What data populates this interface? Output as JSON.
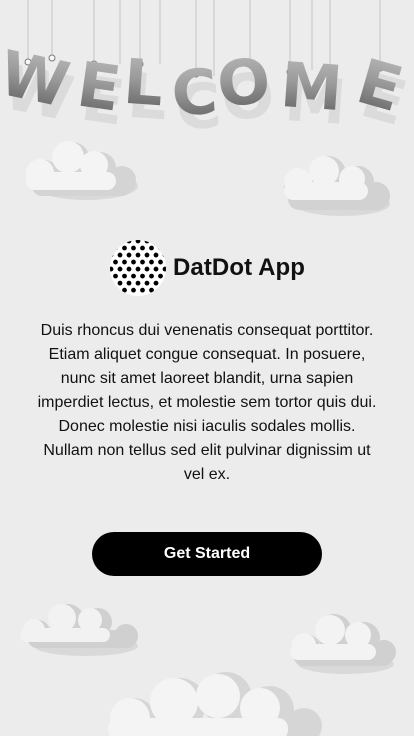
{
  "banner": {
    "letters": [
      "W",
      "E",
      "L",
      "C",
      "O",
      "M",
      "E"
    ]
  },
  "brand": {
    "app_name": "DatDot App",
    "logo_icon": "polka-dot-logo-icon"
  },
  "intro": {
    "description": "Duis rhoncus dui venenatis consequat porttitor. Etiam aliquet congue consequat. In posuere, nunc sit amet laoreet blandit, urna sapien imperdiet lectus, et molestie sem tortor quis dui. Donec molestie nisi iaculis sodales mollis. Nullam non tellus sed elit pulvinar dignissim ut vel ex."
  },
  "cta": {
    "label": "Get Started"
  },
  "colors": {
    "background": "#ececec",
    "button": "#000000",
    "button_text": "#ffffff",
    "text": "#111111"
  }
}
